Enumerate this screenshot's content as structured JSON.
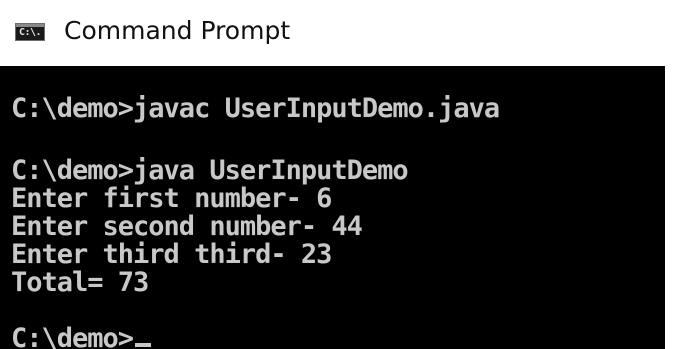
{
  "window": {
    "title": "Command Prompt",
    "icon": "cmd-icon",
    "icon_text": "C:\\."
  },
  "console": {
    "lines": [
      "C:\\demo>javac UserInputDemo.java",
      "C:\\demo>java UserInputDemo",
      "Enter first number- 6",
      "Enter second number- 44",
      "Enter third third- 23",
      "Total= 73",
      "C:\\demo>"
    ],
    "colors": {
      "background": "#000000",
      "foreground": "#c8c8c8"
    }
  }
}
